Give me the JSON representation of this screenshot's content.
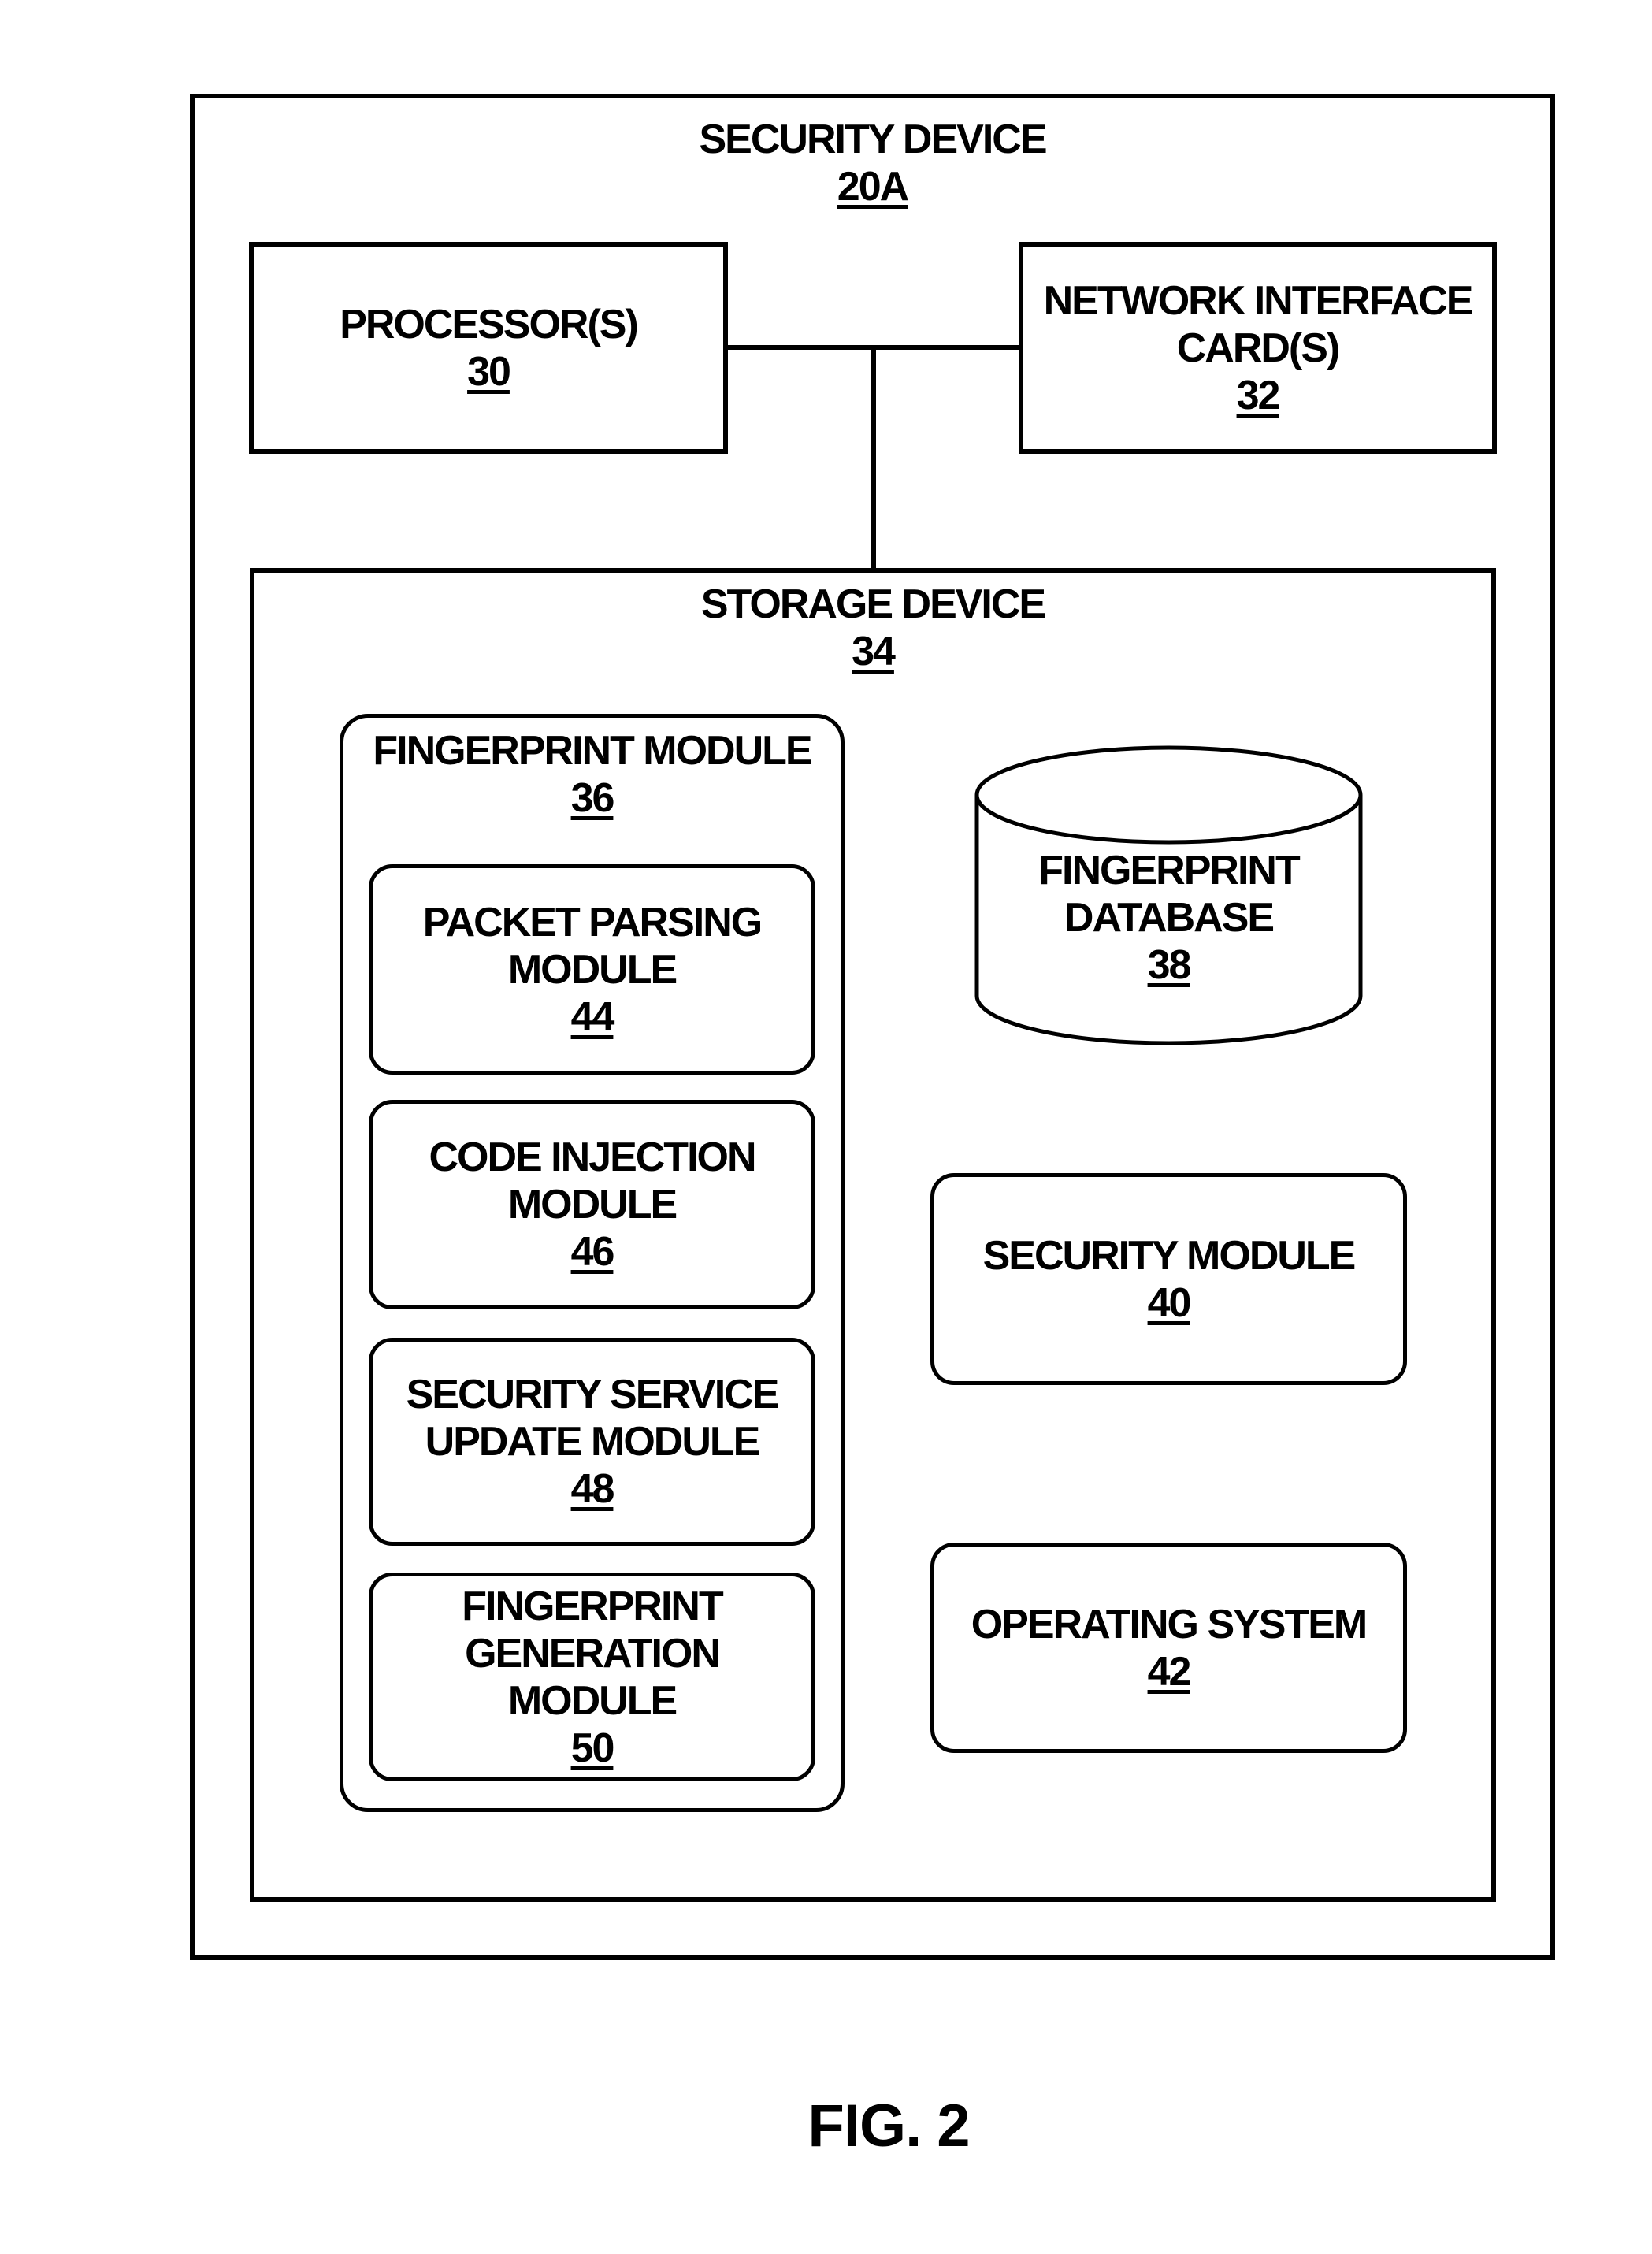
{
  "figure": {
    "caption": "FIG. 2",
    "security_device": {
      "title": "SECURITY DEVICE",
      "ref": "20A"
    },
    "processor": {
      "lines": [
        "PROCESSOR(S)"
      ],
      "ref": "30"
    },
    "network_interface": {
      "lines": [
        "NETWORK INTERFACE",
        "CARD(S)"
      ],
      "ref": "32"
    },
    "storage_device": {
      "title": "STORAGE DEVICE",
      "ref": "34"
    },
    "fingerprint_module": {
      "title": "FINGERPRINT MODULE",
      "ref": "36",
      "submodules": [
        {
          "lines": [
            "PACKET PARSING",
            "MODULE"
          ],
          "ref": "44"
        },
        {
          "lines": [
            "CODE INJECTION",
            "MODULE"
          ],
          "ref": "46"
        },
        {
          "lines": [
            "SECURITY SERVICE",
            "UPDATE MODULE"
          ],
          "ref": "48"
        },
        {
          "lines": [
            "FINGERPRINT",
            "GENERATION",
            "MODULE"
          ],
          "ref": "50"
        }
      ]
    },
    "fingerprint_database": {
      "lines": [
        "FINGERPRINT",
        "DATABASE"
      ],
      "ref": "38"
    },
    "security_module": {
      "lines": [
        "SECURITY MODULE"
      ],
      "ref": "40"
    },
    "operating_system": {
      "lines": [
        "OPERATING SYSTEM"
      ],
      "ref": "42"
    }
  },
  "colors": {
    "stroke": "#000000",
    "background": "#ffffff"
  }
}
